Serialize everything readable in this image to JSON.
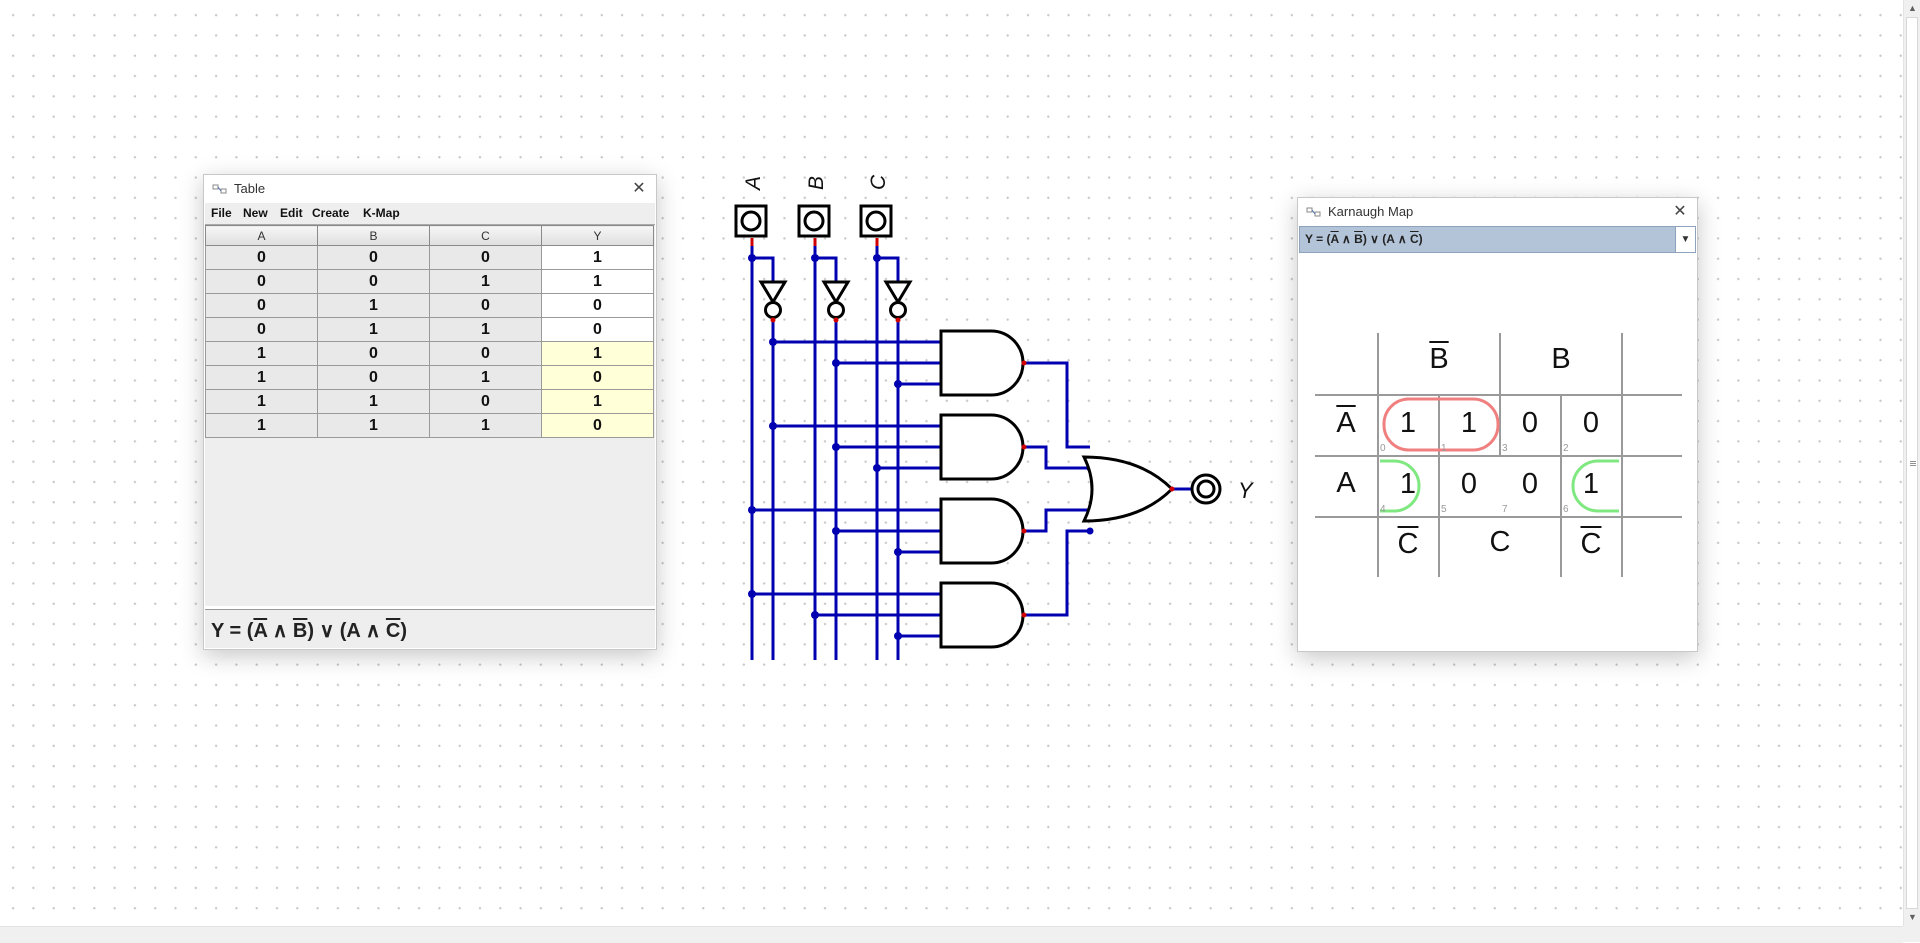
{
  "table_window": {
    "title": "Table",
    "menu": [
      "File",
      "New",
      "Edit",
      "Create",
      "K-Map"
    ],
    "columns": [
      "A",
      "B",
      "C",
      "Y"
    ],
    "rows": [
      [
        "0",
        "0",
        "0",
        "1"
      ],
      [
        "0",
        "0",
        "1",
        "1"
      ],
      [
        "0",
        "1",
        "0",
        "0"
      ],
      [
        "0",
        "1",
        "1",
        "0"
      ],
      [
        "1",
        "0",
        "0",
        "1"
      ],
      [
        "1",
        "0",
        "1",
        "0"
      ],
      [
        "1",
        "1",
        "0",
        "1"
      ],
      [
        "1",
        "1",
        "1",
        "0"
      ]
    ],
    "expression": {
      "p1": "Y = (",
      "a_bar": "A",
      "and1": " ∧ ",
      "b_bar": "B",
      "p2": ") ∨ (A ∧ ",
      "c_bar": "C",
      "p3": ")"
    }
  },
  "circuit": {
    "inputs": [
      "A",
      "B",
      "C"
    ],
    "output": "Y"
  },
  "kmap_window": {
    "title": "Karnaugh Map",
    "expression": {
      "p1": "Y = (",
      "a_bar": "A",
      "and1": " ∧ ",
      "b_bar": "B",
      "p2": ") ∨ (A ∧ ",
      "c_bar": "C",
      "p3": ")"
    },
    "col_header_top": [
      "B",
      "B"
    ],
    "row_headers": [
      "A",
      "A"
    ],
    "col_header_bottom": [
      "C",
      "C",
      "C"
    ],
    "cells": [
      [
        {
          "v": "1",
          "i": "0"
        },
        {
          "v": "1",
          "i": "1"
        },
        {
          "v": "0",
          "i": "3"
        },
        {
          "v": "0",
          "i": "2"
        }
      ],
      [
        {
          "v": "1",
          "i": "4"
        },
        {
          "v": "0",
          "i": "5"
        },
        {
          "v": "0",
          "i": "7"
        },
        {
          "v": "1",
          "i": "6"
        }
      ]
    ],
    "group_colors": {
      "red": "#f08080",
      "green": "#80e880"
    }
  },
  "colors": {
    "wire": "#0000b0",
    "pin_red": "#d00000",
    "highlight_row": "#ffffd8"
  }
}
